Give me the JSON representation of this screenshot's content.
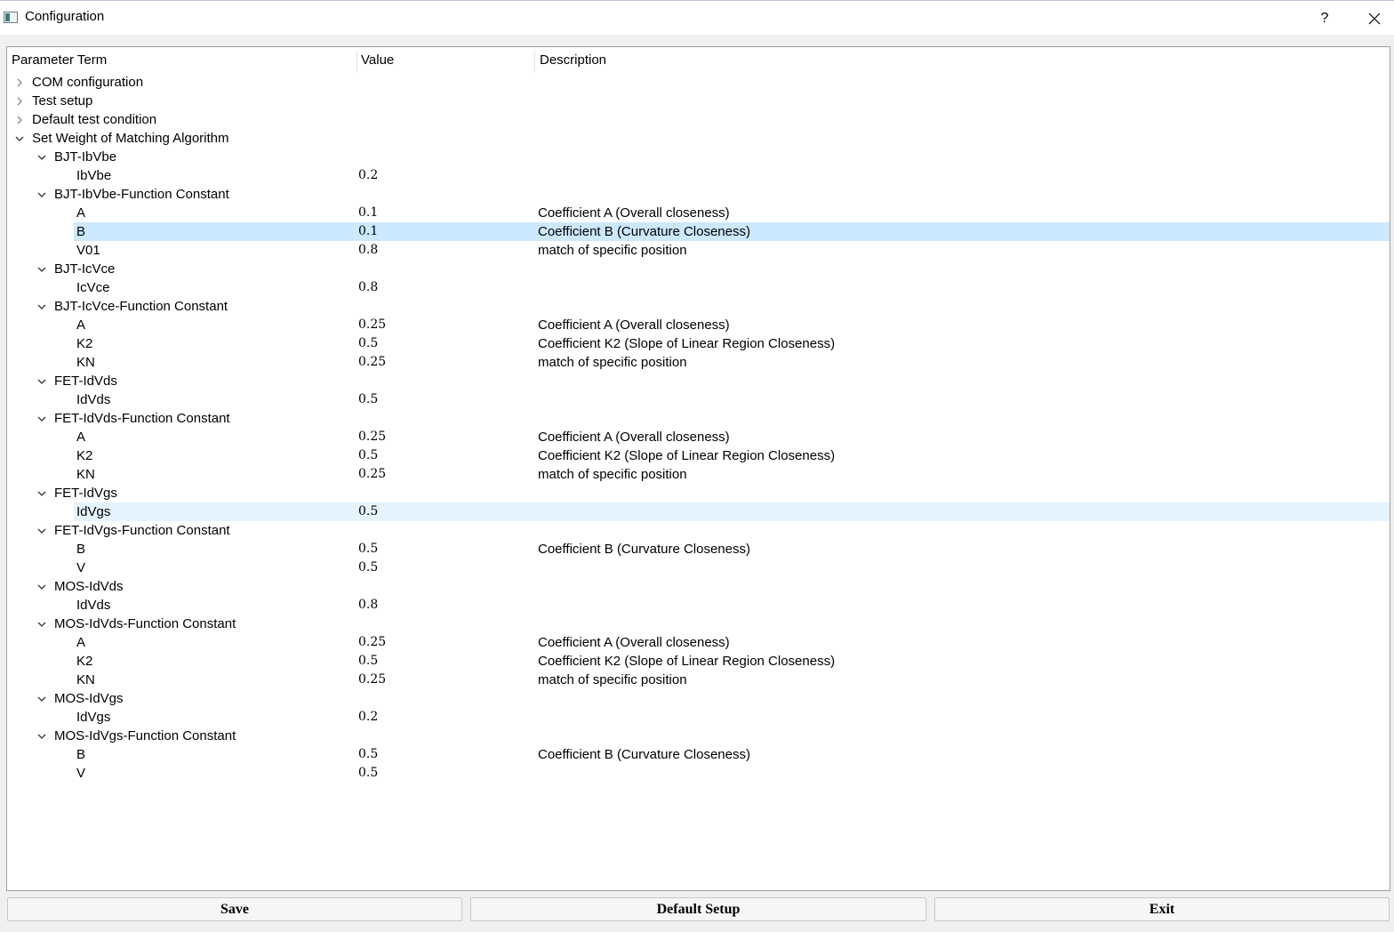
{
  "window": {
    "title": "Configuration",
    "help": "?",
    "close_icon": "close-icon"
  },
  "columns": {
    "term": "Parameter Term",
    "value": "Value",
    "description": "Description"
  },
  "rows": [
    {
      "level": 0,
      "expander": "collapsed",
      "term": "COM configuration",
      "value": "",
      "desc": ""
    },
    {
      "level": 0,
      "expander": "collapsed",
      "term": "Test setup",
      "value": "",
      "desc": ""
    },
    {
      "level": 0,
      "expander": "collapsed",
      "term": "Default test condition",
      "value": "",
      "desc": ""
    },
    {
      "level": 0,
      "expander": "expanded",
      "term": "Set Weight of Matching Algorithm",
      "value": "",
      "desc": ""
    },
    {
      "level": 1,
      "expander": "expanded",
      "term": "BJT-IbVbe",
      "value": "",
      "desc": ""
    },
    {
      "level": 2,
      "expander": "none",
      "term": "IbVbe",
      "value": "0.2",
      "desc": ""
    },
    {
      "level": 1,
      "expander": "expanded",
      "term": "BJT-IbVbe-Function Constant",
      "value": "",
      "desc": ""
    },
    {
      "level": 2,
      "expander": "none",
      "term": "A",
      "value": "0.1",
      "desc": "Coefficient A (Overall closeness)"
    },
    {
      "level": 2,
      "expander": "none",
      "term": "B",
      "value": "0.1",
      "desc": "Coefficient B (Curvature Closeness)",
      "state": "selected"
    },
    {
      "level": 2,
      "expander": "none",
      "term": "V01",
      "value": "0.8",
      "desc": "match of specific position"
    },
    {
      "level": 1,
      "expander": "expanded",
      "term": "BJT-IcVce",
      "value": "",
      "desc": ""
    },
    {
      "level": 2,
      "expander": "none",
      "term": "IcVce",
      "value": "0.8",
      "desc": ""
    },
    {
      "level": 1,
      "expander": "expanded",
      "term": "BJT-IcVce-Function Constant",
      "value": "",
      "desc": ""
    },
    {
      "level": 2,
      "expander": "none",
      "term": "A",
      "value": "0.25",
      "desc": "Coefficient A (Overall closeness)"
    },
    {
      "level": 2,
      "expander": "none",
      "term": "K2",
      "value": "0.5",
      "desc": "Coefficient K2 (Slope of Linear Region Closeness)"
    },
    {
      "level": 2,
      "expander": "none",
      "term": "KN",
      "value": "0.25",
      "desc": "match of specific position"
    },
    {
      "level": 1,
      "expander": "expanded",
      "term": "FET-IdVds",
      "value": "",
      "desc": ""
    },
    {
      "level": 2,
      "expander": "none",
      "term": "IdVds",
      "value": "0.5",
      "desc": ""
    },
    {
      "level": 1,
      "expander": "expanded",
      "term": "FET-IdVds-Function Constant",
      "value": "",
      "desc": ""
    },
    {
      "level": 2,
      "expander": "none",
      "term": "A",
      "value": "0.25",
      "desc": "Coefficient A (Overall closeness)"
    },
    {
      "level": 2,
      "expander": "none",
      "term": "K2",
      "value": "0.5",
      "desc": "Coefficient K2 (Slope of Linear Region Closeness)"
    },
    {
      "level": 2,
      "expander": "none",
      "term": "KN",
      "value": "0.25",
      "desc": "match of specific position"
    },
    {
      "level": 1,
      "expander": "expanded",
      "term": "FET-IdVgs",
      "value": "",
      "desc": ""
    },
    {
      "level": 2,
      "expander": "none",
      "term": "IdVgs",
      "value": "0.5",
      "desc": "",
      "state": "hover"
    },
    {
      "level": 1,
      "expander": "expanded",
      "term": "FET-IdVgs-Function Constant",
      "value": "",
      "desc": ""
    },
    {
      "level": 2,
      "expander": "none",
      "term": "B",
      "value": "0.5",
      "desc": "Coefficient B (Curvature Closeness)"
    },
    {
      "level": 2,
      "expander": "none",
      "term": "V",
      "value": "0.5",
      "desc": ""
    },
    {
      "level": 1,
      "expander": "expanded",
      "term": "MOS-IdVds",
      "value": "",
      "desc": ""
    },
    {
      "level": 2,
      "expander": "none",
      "term": "IdVds",
      "value": "0.8",
      "desc": ""
    },
    {
      "level": 1,
      "expander": "expanded",
      "term": "MOS-IdVds-Function Constant",
      "value": "",
      "desc": ""
    },
    {
      "level": 2,
      "expander": "none",
      "term": "A",
      "value": "0.25",
      "desc": "Coefficient A (Overall closeness)"
    },
    {
      "level": 2,
      "expander": "none",
      "term": "K2",
      "value": "0.5",
      "desc": "Coefficient K2 (Slope of Linear Region Closeness)"
    },
    {
      "level": 2,
      "expander": "none",
      "term": "KN",
      "value": "0.25",
      "desc": "match of specific position"
    },
    {
      "level": 1,
      "expander": "expanded",
      "term": "MOS-IdVgs",
      "value": "",
      "desc": ""
    },
    {
      "level": 2,
      "expander": "none",
      "term": "IdVgs",
      "value": "0.2",
      "desc": ""
    },
    {
      "level": 1,
      "expander": "expanded",
      "term": "MOS-IdVgs-Function Constant",
      "value": "",
      "desc": ""
    },
    {
      "level": 2,
      "expander": "none",
      "term": "B",
      "value": "0.5",
      "desc": "Coefficient B (Curvature Closeness)"
    },
    {
      "level": 2,
      "expander": "none",
      "term": "V",
      "value": "0.5",
      "desc": ""
    }
  ],
  "buttons": {
    "save": "Save",
    "default_setup": "Default Setup",
    "exit": "Exit"
  }
}
